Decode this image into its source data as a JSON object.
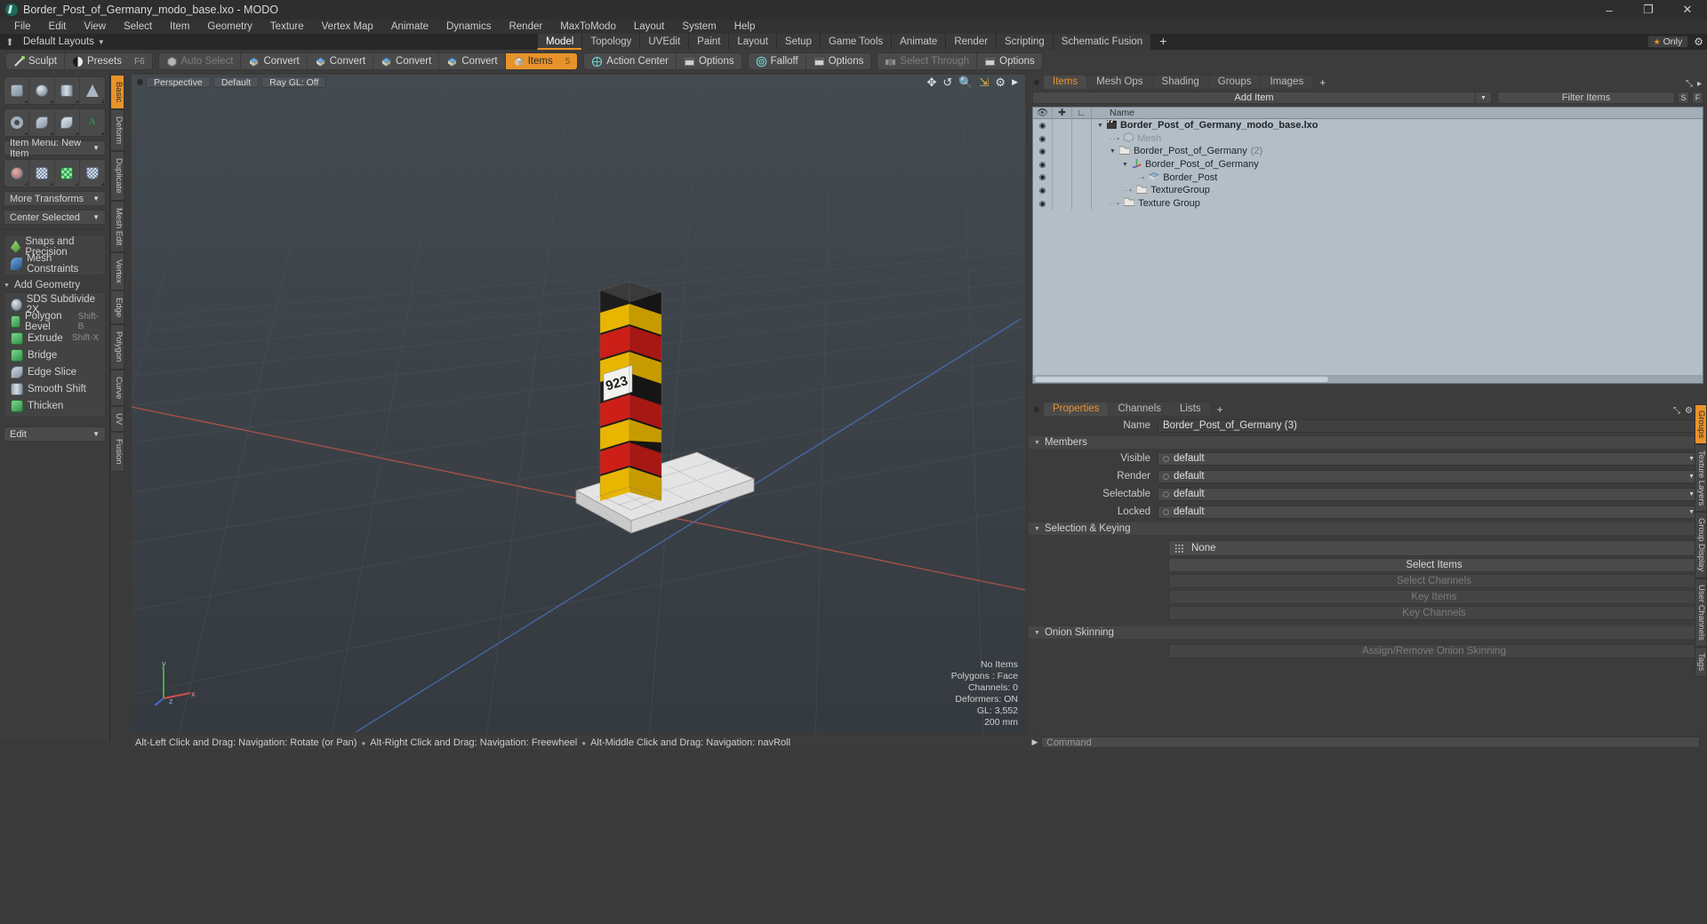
{
  "titlebar": {
    "title": "Border_Post_of_Germany_modo_base.lxo - MODO",
    "minimize": "–",
    "maximize": "❐",
    "close": "✕"
  },
  "menu": [
    "File",
    "Edit",
    "View",
    "Select",
    "Item",
    "Geometry",
    "Texture",
    "Vertex Map",
    "Animate",
    "Dynamics",
    "Render",
    "MaxToModo",
    "Layout",
    "System",
    "Help"
  ],
  "layoutbar": {
    "home_icon": "⬆",
    "default_layouts": "Default Layouts",
    "tabs": [
      "Model",
      "Topology",
      "UVEdit",
      "Paint",
      "Layout",
      "Setup",
      "Game Tools",
      "Animate",
      "Render",
      "Scripting",
      "Schematic Fusion"
    ],
    "active_tab": "Model",
    "plus": "+",
    "only_label": "Only",
    "star": "★"
  },
  "modebar": {
    "group1": [
      {
        "label": "Sculpt",
        "icon": "sculpt-brush-icon",
        "shortcut": ""
      },
      {
        "label": "Presets",
        "icon": "presets-sphere-icon",
        "shortcut": "F6"
      }
    ],
    "group2": [
      {
        "label": "Auto Select",
        "icon": "cube-gray-icon",
        "dim": true
      },
      {
        "label": "Convert",
        "icon": "convert-blue-icon"
      },
      {
        "label": "Convert",
        "icon": "convert-blue-icon"
      },
      {
        "label": "Convert",
        "icon": "convert-blue-icon"
      },
      {
        "label": "Convert",
        "icon": "convert-blue-icon"
      },
      {
        "label": "Items",
        "icon": "items-cube-icon",
        "shortcut": "5",
        "active": true
      }
    ],
    "group3": [
      {
        "label": "Action Center",
        "icon": "action-center-icon"
      },
      {
        "label": "Options",
        "icon": "options-panel-icon"
      }
    ],
    "group4": [
      {
        "label": "Falloff",
        "icon": "falloff-target-icon"
      },
      {
        "label": "Options",
        "icon": "options-panel-icon"
      }
    ],
    "group5": [
      {
        "label": "Select Through",
        "icon": "select-through-icon",
        "dim": true
      },
      {
        "label": "Options",
        "icon": "options-panel-icon"
      }
    ]
  },
  "left_panel": {
    "prim_row1": [
      "cube-primitive-icon",
      "sphere-primitive-icon",
      "cylinder-primitive-icon",
      "cone-primitive-icon"
    ],
    "prim_row2": [
      "torus-primitive-icon",
      "spiral-primitive-icon",
      "vertex-shape-icon",
      "text-tool-icon"
    ],
    "item_menu": "Item Menu: New Item",
    "xform_row": [
      "transform-gizmo-icon",
      "grid-mesh-icon",
      "uv-checker-icon",
      "falloff-mesh-icon"
    ],
    "more_transforms": "More Transforms",
    "center_selected": "Center Selected",
    "snaps": "Snaps and Precision",
    "mesh_constraints": "Mesh Constraints",
    "add_geometry_header": "Add Geometry",
    "geometry_tools": [
      {
        "label": "SDS Subdivide 2X",
        "shortcut": "",
        "icon": "sds-subdivide-icon"
      },
      {
        "label": "Polygon Bevel",
        "shortcut": "Shift-B",
        "icon": "polygon-bevel-icon"
      },
      {
        "label": "Extrude",
        "shortcut": "Shift-X",
        "icon": "extrude-icon"
      },
      {
        "label": "Bridge",
        "shortcut": "",
        "icon": "bridge-icon"
      },
      {
        "label": "Edge Slice",
        "shortcut": "",
        "icon": "edge-slice-icon"
      },
      {
        "label": "Smooth Shift",
        "shortcut": "",
        "icon": "smooth-shift-icon"
      },
      {
        "label": "Thicken",
        "shortcut": "",
        "icon": "thicken-icon"
      }
    ],
    "edit_menu": "Edit",
    "vtabs": [
      "Basic",
      "Deform",
      "Duplicate",
      "Mesh Edit",
      "Vertex",
      "Edge",
      "Polygon",
      "Curve",
      "UV",
      "Fusion"
    ],
    "vtabs_active": "Basic"
  },
  "viewport": {
    "tags": [
      "Perspective",
      "Default",
      "Ray GL: Off"
    ],
    "icons": [
      "pan-icon",
      "rotate-icon",
      "zoom-icon",
      "fit-icon",
      "gear-icon",
      "play-icon"
    ],
    "stats": [
      "No Items",
      "Polygons : Face",
      "Channels: 0",
      "Deformers: ON",
      "GL: 3,552",
      "200 mm"
    ],
    "axis_labels": {
      "y": "y",
      "x": "x",
      "z": "z"
    }
  },
  "statusbar": {
    "hint1": "Alt-Left Click and Drag: Navigation: Rotate (or Pan)",
    "hint2": "Alt-Right Click and Drag: Navigation: Freewheel",
    "hint3": "Alt-Middle Click and Drag: Navigation: navRoll"
  },
  "items_panel": {
    "tabs": [
      "Items",
      "Mesh Ops",
      "Shading",
      "Groups",
      "Images"
    ],
    "active_tab": "Items",
    "tab_plus": "+",
    "add_item": "Add Item",
    "filter_placeholder": "Filter Items",
    "small_buttons": [
      "S",
      "F"
    ],
    "columns": {
      "visible": "eye-icon",
      "lock": "add-icon",
      "transform": "axis-icon",
      "name": "Name"
    },
    "rows": [
      {
        "name": "Border_Post_of_Germany_modo_base.lxo",
        "indent": 0,
        "icon": "scene-clapper-icon",
        "bold": true,
        "count": "",
        "muted": false,
        "has_caret": true
      },
      {
        "name": "Mesh",
        "indent": 1,
        "icon": "mesh-shield-icon",
        "bold": false,
        "count": "",
        "muted": true,
        "has_caret": false
      },
      {
        "name": "Border_Post_of_Germany",
        "indent": 1,
        "icon": "group-folder-icon",
        "bold": false,
        "count": "(2)",
        "muted": false,
        "has_caret": true
      },
      {
        "name": "Border_Post_of_Germany",
        "indent": 2,
        "icon": "locator-axis-icon",
        "bold": false,
        "count": "",
        "muted": false,
        "has_caret": true
      },
      {
        "name": "Border_Post",
        "indent": 3,
        "icon": "mesh-item-icon",
        "bold": false,
        "count": "",
        "muted": false,
        "has_caret": false
      },
      {
        "name": "TextureGroup",
        "indent": 2,
        "icon": "group-folder-icon",
        "bold": false,
        "count": "",
        "muted": false,
        "has_caret": false
      },
      {
        "name": "Texture Group",
        "indent": 1,
        "icon": "group-folder-icon",
        "bold": false,
        "count": "",
        "muted": false,
        "has_caret": false
      }
    ]
  },
  "properties_panel": {
    "tabs": [
      "Properties",
      "Channels",
      "Lists"
    ],
    "active_tab": "Properties",
    "tab_plus": "+",
    "name_label": "Name",
    "name_value": "Border_Post_of_Germany (3)",
    "members_header": "Members",
    "members": [
      {
        "label": "Visible",
        "value": "default"
      },
      {
        "label": "Render",
        "value": "default"
      },
      {
        "label": "Selectable",
        "value": "default"
      },
      {
        "label": "Locked",
        "value": "default"
      }
    ],
    "selection_header": "Selection & Keying",
    "selection_value": "None",
    "buttons": [
      {
        "label": "Select Items",
        "dim": false
      },
      {
        "label": "Select Channels",
        "dim": true
      },
      {
        "label": "Key Items",
        "dim": true
      },
      {
        "label": "Key Channels",
        "dim": true
      }
    ],
    "onion_header": "Onion Skinning",
    "onion_button": "Assign/Remove Onion Skinning",
    "vtabs": [
      "Groups",
      "Texture Layers",
      "Group Display",
      "User Channels",
      "Tags"
    ],
    "vtabs_active": "Groups"
  },
  "command_bar": {
    "placeholder": "Command",
    "arrow": "▶"
  },
  "colors": {
    "accent": "#e8932a",
    "panel": "#3c3c3c",
    "viewport": "#3b4247",
    "tree": "#b4bec6"
  }
}
